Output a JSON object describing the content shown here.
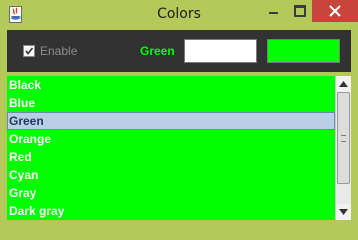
{
  "window": {
    "title": "Colors",
    "accent_color": "#b5c85a",
    "close_color": "#c7453b"
  },
  "toolbar": {
    "enable_label": "Enable",
    "enable_checked": true,
    "color_label": "Green",
    "name_input_value": "",
    "swatch_color": "#00ff00"
  },
  "list": {
    "background": "#00ff00",
    "items": [
      "Black",
      "Blue",
      "Green",
      "Orange",
      "Red",
      "Cyan",
      "Gray",
      "Dark gray"
    ],
    "selected": "Green"
  },
  "icons": {
    "app": "java-icon",
    "minimize": "minimize-icon",
    "maximize": "maximize-icon",
    "close": "close-icon",
    "scroll_up": "chevron-up-icon",
    "scroll_down": "chevron-down-icon"
  }
}
